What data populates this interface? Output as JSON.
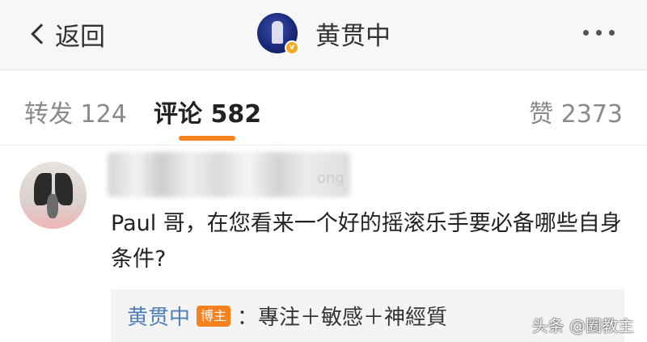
{
  "header": {
    "back_label": "返回",
    "title": "黄贯中",
    "verified_mark": "v"
  },
  "tabs": {
    "repost": "转发 124",
    "comment": "评论 582",
    "like": "赞 2373"
  },
  "comment": {
    "username_fragment": "ong",
    "text": "Paul 哥，在您看来一个好的摇滚乐手要必备哪些自身条件?",
    "reply": {
      "author": "黄贯中",
      "badge": "博主",
      "content": "：專注＋敏感＋神經質"
    }
  },
  "watermark": "头条 @圈教主",
  "colors": {
    "accent": "#f5811f",
    "link": "#4e7fb8"
  }
}
